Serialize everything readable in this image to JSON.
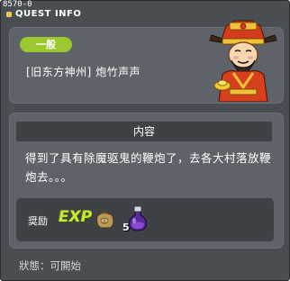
{
  "window": {
    "dev_id": "8570-0",
    "title": "QUEST INFO"
  },
  "quest": {
    "type_badge": "一般",
    "name": "[旧东方神州] 炮竹声声",
    "npc_icon": "god-of-wealth-npc-icon"
  },
  "content": {
    "header": "内容",
    "description": "得到了具有除魔驱鬼的鞭炮了，去各大村落放鞭炮去。。。"
  },
  "reward": {
    "label": "奨励",
    "exp_label": "EXP",
    "items": [
      {
        "icon": "meso-bag-icon",
        "quantity": ""
      },
      {
        "icon": "purple-potion-icon",
        "quantity": "5"
      }
    ]
  },
  "status": {
    "label": "狀態：",
    "value": "可開始"
  },
  "colors": {
    "window_bg": "#4a4d52",
    "panel_bg": "#5f6268",
    "header_bg": "#3e4146",
    "badge_green": "#9bc730",
    "exp_green": "#c9e83a"
  }
}
